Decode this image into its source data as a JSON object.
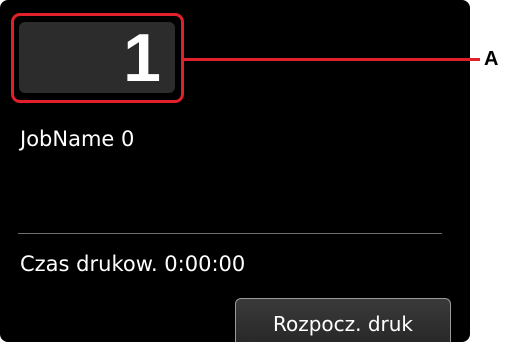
{
  "screen": {
    "copies_count": "1",
    "job_name": "JobName 0",
    "print_time": "Czas drukow. 0:00:00",
    "start_button_label": "Rozpocz. druk"
  },
  "annotation": {
    "callout_label": "A",
    "highlight_color": "#e0202a"
  },
  "colors": {
    "screen_background": "#000000",
    "counter_background": "#2c2c2c",
    "text": "#ffffff"
  }
}
